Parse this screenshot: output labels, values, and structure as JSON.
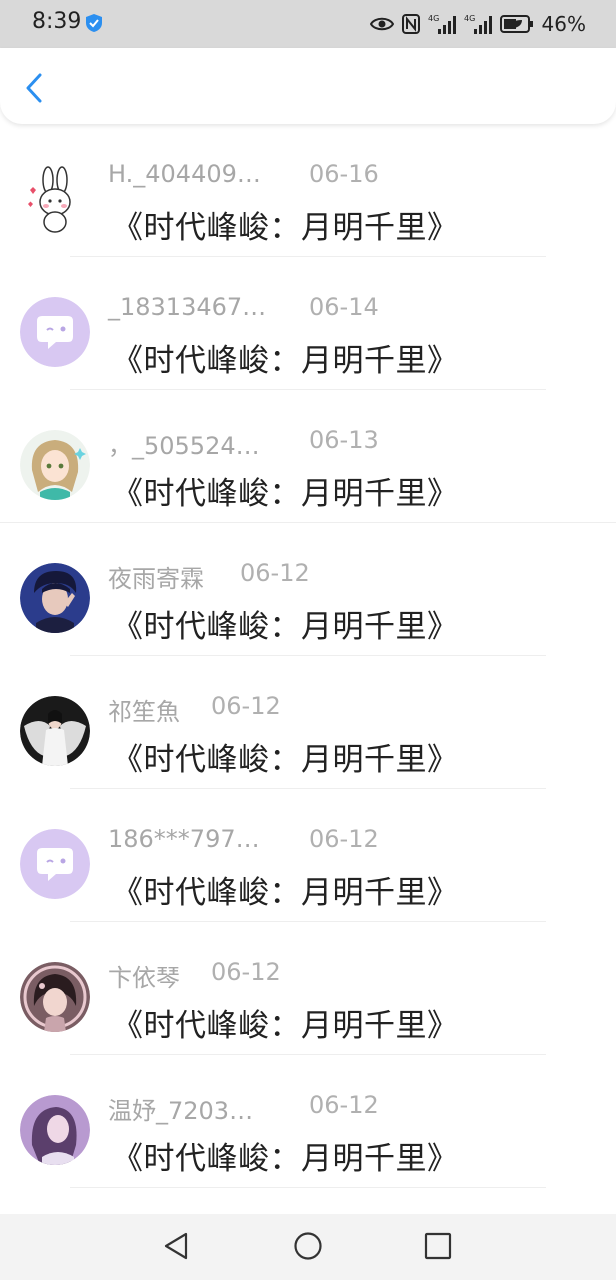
{
  "status_bar": {
    "time": "8:39",
    "battery": "46%",
    "network_labels": [
      "4G",
      "4G"
    ]
  },
  "header": {
    "back_icon": "chevron-left-icon",
    "accent_color": "#2b8ff0"
  },
  "messages": [
    {
      "name": "H._404409…",
      "date": "06-16",
      "text": "《时代峰峻：月明千里》",
      "avatar": "rabbit-sticker"
    },
    {
      "name": "_18313467…",
      "date": "06-14",
      "text": "《时代峰峻：月明千里》",
      "avatar": "default-chat-bubble"
    },
    {
      "name": "，_505524…",
      "date": "06-13",
      "text": "《时代峰峻：月明千里》",
      "avatar": "anime-girl"
    },
    {
      "name": "夜雨寄霖",
      "date": "06-12",
      "text": "《时代峰峻：月明千里》",
      "avatar": "photo-boy"
    },
    {
      "name": "祁笙魚",
      "date": "06-12",
      "text": "《时代峰峻：月明千里》",
      "avatar": "photo-white-dress"
    },
    {
      "name": "186***797…",
      "date": "06-12",
      "text": "《时代峰峻：月明千里》",
      "avatar": "default-chat-bubble"
    },
    {
      "name": "卞依琴",
      "date": "06-12",
      "text": "《时代峰峻：月明千里》",
      "avatar": "photo-girl-frame"
    },
    {
      "name": "温妤_7203…",
      "date": "06-12",
      "text": "《时代峰峻：月明千里》",
      "avatar": "photo-purple-girl"
    }
  ],
  "nav_bar": {
    "back_icon": "triangle-back-icon",
    "home_icon": "circle-home-icon",
    "recents_icon": "square-recents-icon"
  }
}
